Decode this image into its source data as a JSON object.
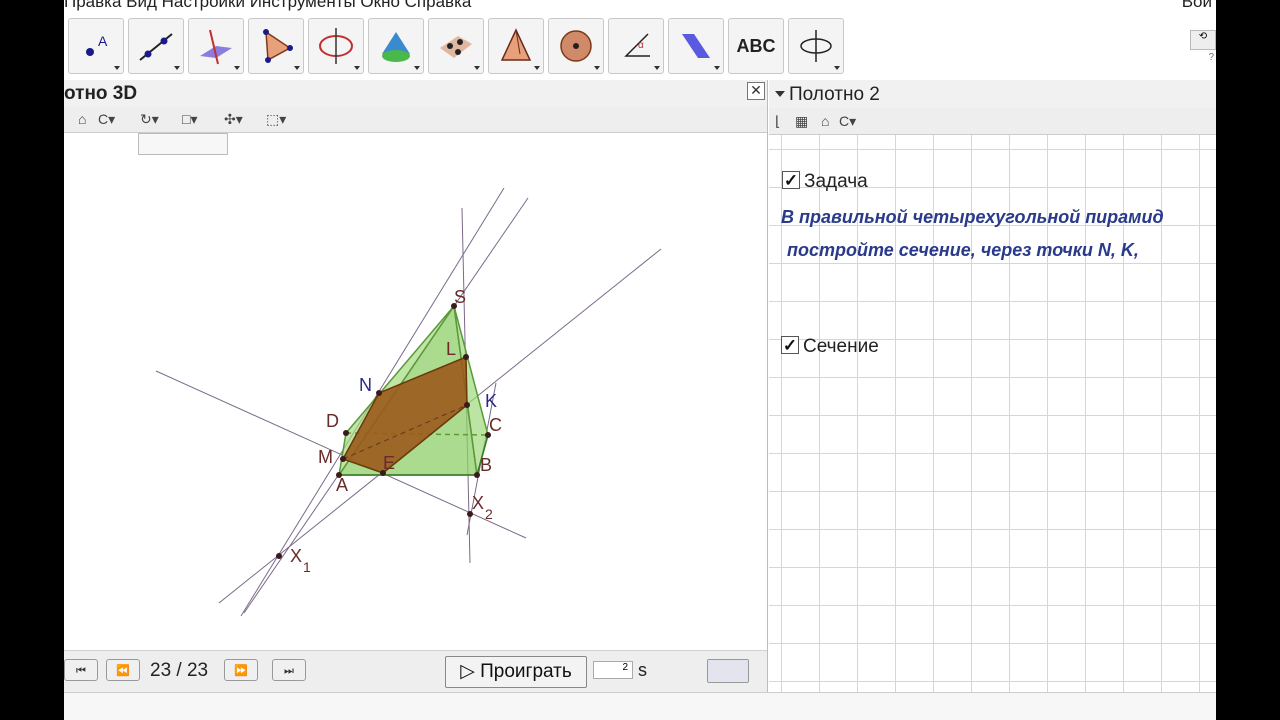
{
  "menu": {
    "items": "Правка  Вид  Настройки  Инструменты  Окно  Справка",
    "right": "Вой"
  },
  "toolbar": {
    "tools": [
      {
        "icon": "point-icon"
      },
      {
        "icon": "line-icon"
      },
      {
        "icon": "plane-intersect-icon"
      },
      {
        "icon": "polygon-icon"
      },
      {
        "icon": "circle-axis-icon"
      },
      {
        "icon": "cone-icon"
      },
      {
        "icon": "plane-points-icon"
      },
      {
        "icon": "pyramid-icon"
      },
      {
        "icon": "sphere-icon"
      },
      {
        "icon": "angle-icon"
      },
      {
        "icon": "reflect-icon"
      },
      {
        "icon": "text-icon",
        "label": "ABC"
      },
      {
        "icon": "rotate-icon"
      }
    ]
  },
  "view3d": {
    "title": "отно 3D",
    "close_symbol": "✕",
    "nav": {
      "page": "23 / 23",
      "play_label": "▷ Проиграть",
      "speed": "2",
      "speed_unit": "s"
    },
    "points": {
      "S": "S",
      "L": "L",
      "N": "N",
      "K": "K",
      "C": "C",
      "D": "D",
      "M": "M",
      "E": "E",
      "A": "A",
      "B": "B",
      "X2": "X",
      "X2sub": "2",
      "X1": "X",
      "X1sub": "1"
    },
    "colors": {
      "pyramid": "#8fcf6a",
      "section": "#9a5a1c",
      "lines": "#7a6a88"
    }
  },
  "view2": {
    "title": "Полотно 2",
    "checkbox1": {
      "checked": "✓",
      "label": "Задача"
    },
    "task_line1": "В правильной четырехугольной пирамид",
    "task_line2": "постройте сечение, через точки N, K,",
    "checkbox2": {
      "checked": "✓",
      "label": "Сечение"
    }
  }
}
